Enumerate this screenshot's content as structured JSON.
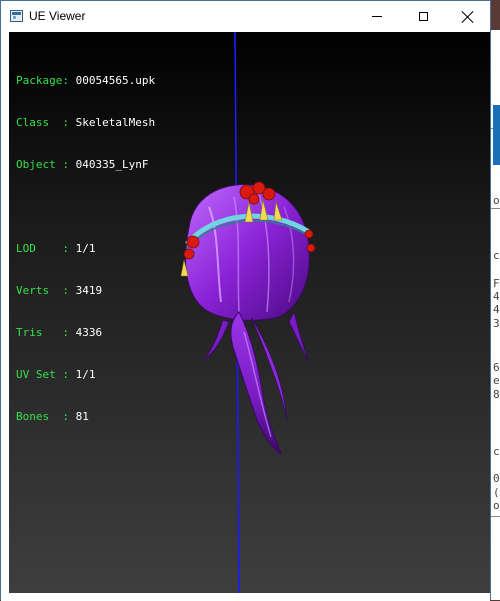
{
  "window": {
    "title": "UE Viewer",
    "controls": {
      "minimize": "minimize-icon",
      "maximize": "maximize-icon",
      "close": "close-icon"
    }
  },
  "info": {
    "package_label": "Package",
    "package_value": "00054565.upk",
    "class_label": "Class  ",
    "class_value": "SkeletalMesh",
    "object_label": "Object ",
    "object_value": "040335_LynF",
    "lod_label": "LOD    ",
    "lod_value": "1/1",
    "verts_label": "Verts  ",
    "verts_value": "3419",
    "tris_label": "Tris   ",
    "tris_value": "4336",
    "uvset_label": "UV Set ",
    "uvset_value": "1/1",
    "bones_label": "Bones  ",
    "bones_value": "81"
  },
  "background_window": {
    "glyphs": [
      "o",
      "c",
      "F",
      "4",
      "4",
      "3",
      "6",
      "e",
      "8",
      "c",
      "0",
      "(",
      "o"
    ]
  },
  "colors": {
    "label": "#33e24a",
    "value": "#ffffff",
    "axis": "#1a1aff",
    "hair": "#9a2be0",
    "flower": "#d81a10",
    "tassel": "#e8d24a"
  }
}
